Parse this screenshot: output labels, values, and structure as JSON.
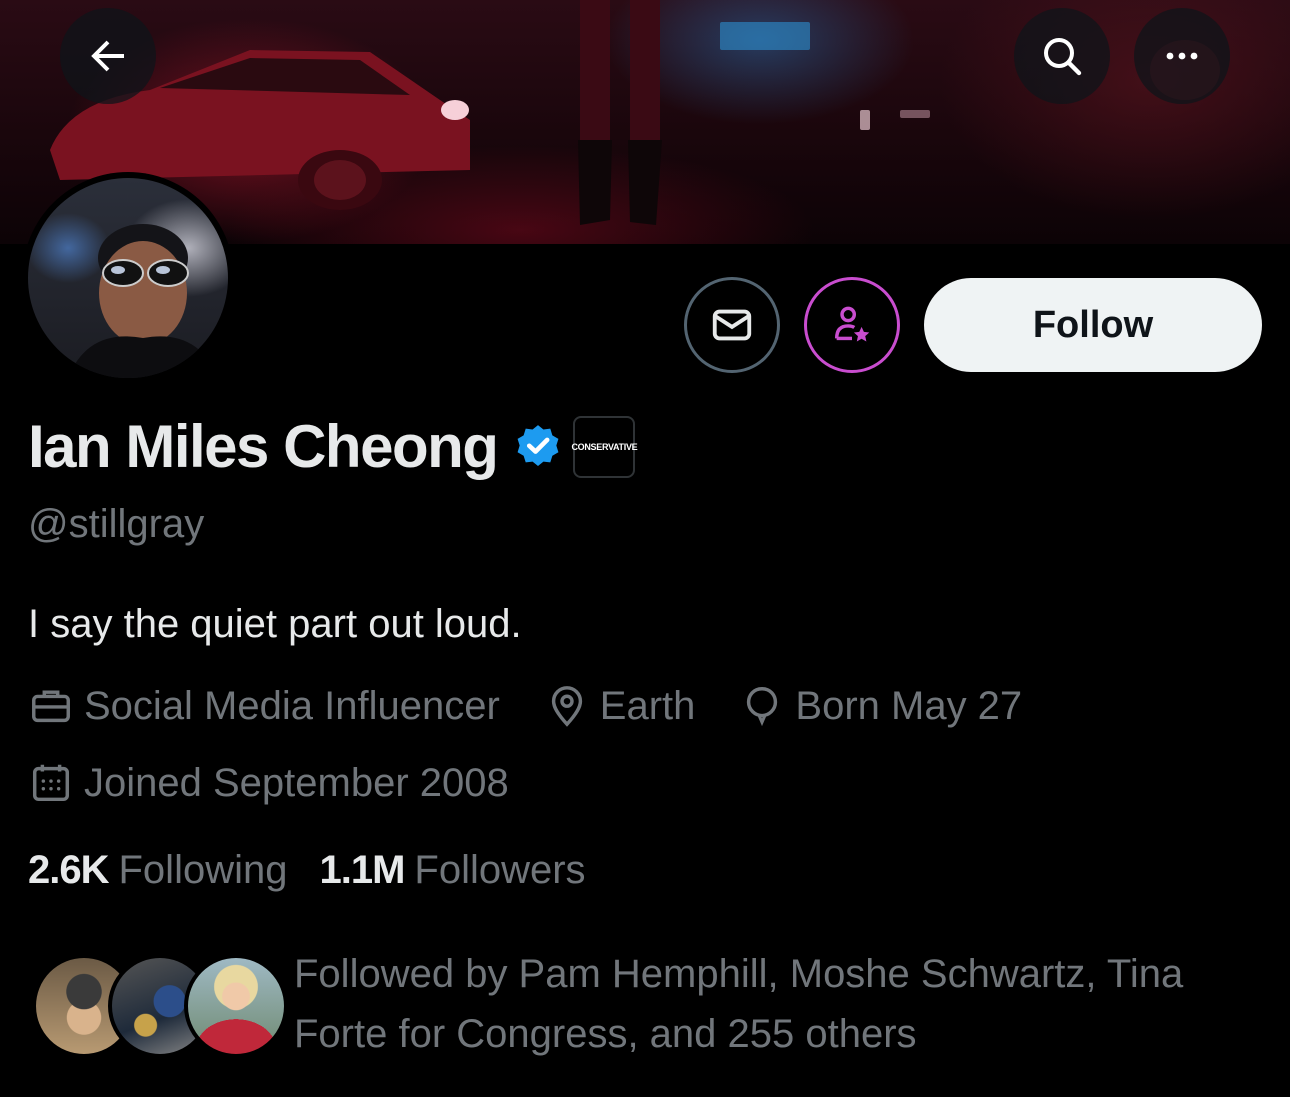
{
  "header": {
    "back_icon": "arrow-left-icon",
    "search_icon": "search-icon",
    "more_icon": "more-horizontal-icon"
  },
  "actions": {
    "message_icon": "envelope-icon",
    "subscribe_icon": "person-star-icon",
    "follow_label": "Follow"
  },
  "profile": {
    "name": "Ian Miles Cheong",
    "verified": true,
    "affiliation_badge": "CONSERVATIVE",
    "handle": "@stillgray",
    "bio": "I say the quiet part out loud.",
    "profession": "Social Media Influencer",
    "location": "Earth",
    "birthday": "Born May 27",
    "joined": "Joined September 2008"
  },
  "stats": {
    "following_count": "2.6K",
    "following_label": "Following",
    "followers_count": "1.1M",
    "followers_label": "Followers"
  },
  "followed_by": {
    "text": "Followed by Pam Hemphill, Moshe Schwartz, Tina Forte for Congress, and 255 others"
  },
  "colors": {
    "background": "#000000",
    "text_primary": "#e7e9ea",
    "text_secondary": "#71767b",
    "verified_blue": "#1d9bf0",
    "subscribe_purple": "#c94dcf",
    "follow_button_bg": "#eff3f4"
  }
}
